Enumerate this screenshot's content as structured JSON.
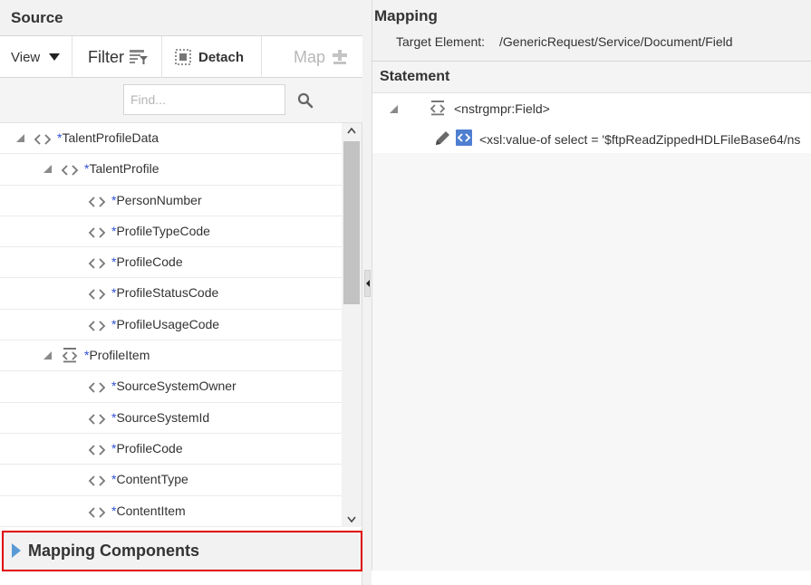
{
  "source": {
    "title": "Source",
    "toolbar": {
      "view_label": "View",
      "filter_label": "Filter",
      "detach_label": "Detach",
      "map_label": "Map"
    },
    "search": {
      "placeholder": "Find..."
    },
    "tree": [
      {
        "label": "TalentProfileData",
        "required": "*",
        "icon": "element-icon",
        "expanded": true
      },
      {
        "label": "TalentProfile",
        "required": "*",
        "icon": "element-icon",
        "expanded": true
      },
      {
        "label": "PersonNumber",
        "required": "*",
        "icon": "element-icon"
      },
      {
        "label": "ProfileTypeCode",
        "required": "*",
        "icon": "element-icon"
      },
      {
        "label": "ProfileCode",
        "required": "*",
        "icon": "element-icon"
      },
      {
        "label": "ProfileStatusCode",
        "required": "*",
        "icon": "element-icon"
      },
      {
        "label": "ProfileUsageCode",
        "required": "*",
        "icon": "element-icon"
      },
      {
        "label": "ProfileItem",
        "required": "*",
        "icon": "repeating-element-icon",
        "expanded": true
      },
      {
        "label": "SourceSystemOwner",
        "required": "*",
        "icon": "element-icon"
      },
      {
        "label": "SourceSystemId",
        "required": "*",
        "icon": "element-icon"
      },
      {
        "label": "ProfileCode",
        "required": "*",
        "icon": "element-icon"
      },
      {
        "label": "ContentType",
        "required": "*",
        "icon": "element-icon"
      },
      {
        "label": "ContentItem",
        "required": "*",
        "icon": "element-icon"
      }
    ],
    "mapping_components_label": "Mapping Components"
  },
  "mapping": {
    "title": "Mapping",
    "target_label": "Target Element:",
    "target_value": "/GenericRequest/Service/Document/Field",
    "statement_title": "Statement",
    "statement_node": "<nstrgmpr:Field>",
    "statement_expression": "<xsl:value-of select = '$ftpReadZippedHDLFileBase64/ns"
  },
  "colors": {
    "required_marker": "#2f4fd6",
    "highlight_border": "#e00000",
    "expand_arrow": "#5a9ad5",
    "xsl_badge": "#4f7fd0"
  }
}
